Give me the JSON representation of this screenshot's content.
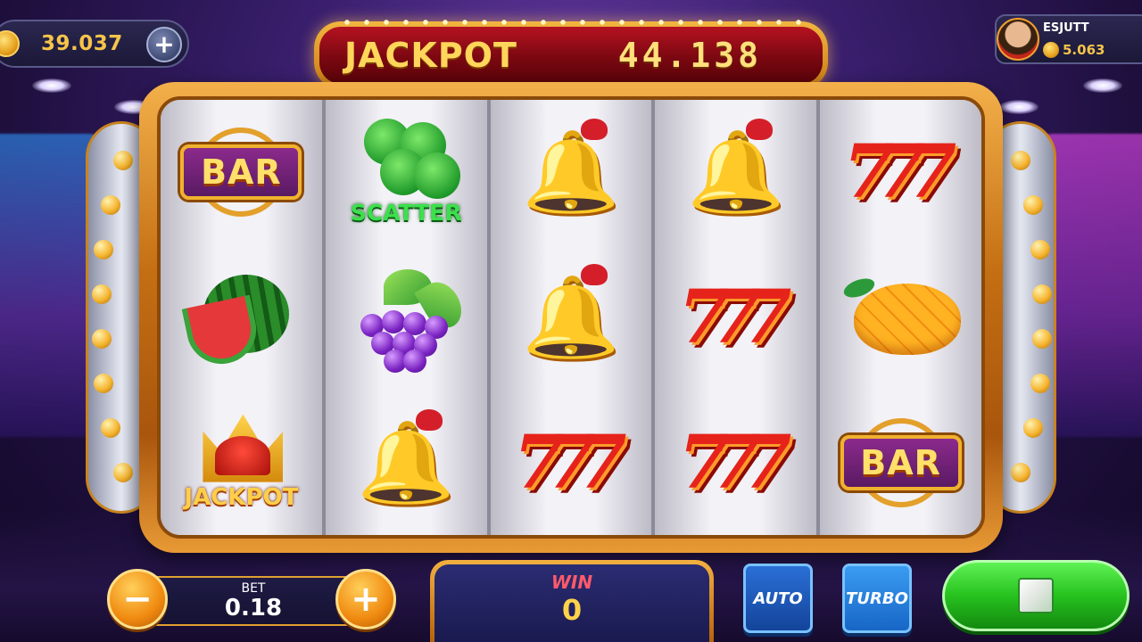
{
  "header": {
    "balance": "39.037",
    "jackpot_label": "JACKPOT",
    "jackpot_value": "44.138",
    "player_name": "ESJUTT",
    "player_balance": "5.063"
  },
  "reels": [
    [
      {
        "symbol": "bar",
        "label": "BAR"
      },
      {
        "symbol": "watermelon"
      },
      {
        "symbol": "jackpot",
        "label": "JACKPOT"
      }
    ],
    [
      {
        "symbol": "scatter",
        "label": "SCATTER"
      },
      {
        "symbol": "grapes"
      },
      {
        "symbol": "bell"
      }
    ],
    [
      {
        "symbol": "bell"
      },
      {
        "symbol": "bell"
      },
      {
        "symbol": "seven",
        "label": "777"
      }
    ],
    [
      {
        "symbol": "bell"
      },
      {
        "symbol": "seven",
        "label": "777"
      },
      {
        "symbol": "seven",
        "label": "777"
      }
    ],
    [
      {
        "symbol": "seven",
        "label": "777"
      },
      {
        "symbol": "mango"
      },
      {
        "symbol": "bar",
        "label": "BAR"
      }
    ]
  ],
  "controls": {
    "bet_label": "BET",
    "bet_value": "0.18",
    "minus": "−",
    "plus": "+",
    "win_label": "WIN",
    "win_value": "0",
    "auto_label": "AUTO",
    "turbo_label": "TURBO"
  },
  "colors": {
    "accent_gold": "#f2b640",
    "jackpot_red": "#b51220",
    "spin_green": "#27c21e"
  }
}
